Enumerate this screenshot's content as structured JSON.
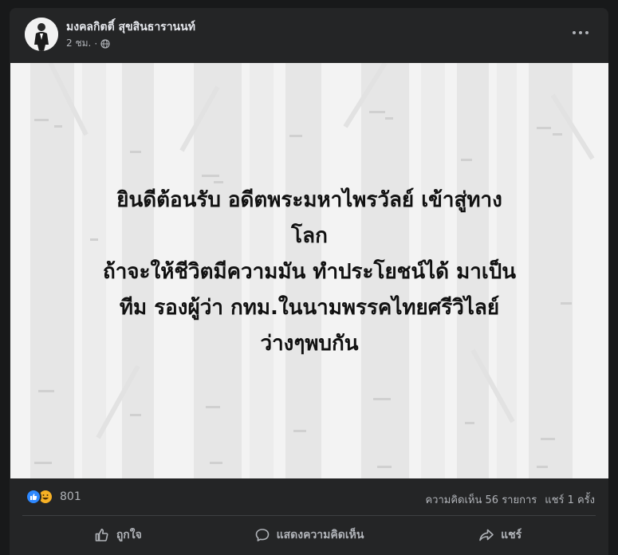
{
  "post": {
    "author": "มงคลกิตติ์ สุขสินธารานนท์",
    "time": "2 ชม.",
    "separator": "·",
    "privacy_icon": "globe-icon",
    "lines": [
      "ยินดีต้อนรับ อดีตพระมหาไพรวัลย์ เข้าสู่ทาง",
      "โลก",
      "ถ้าจะให้ชีวิตมีความมัน ทำประโยชน์ได้ มาเป็น",
      "ทีม รองผู้ว่า กทม.ในนามพรรคไทยศรีวิไลย์",
      "ว่างๆพบกัน"
    ]
  },
  "stats": {
    "reaction_count": "801",
    "comments": "ความคิดเห็น 56 รายการ",
    "shares": "แชร์ 1 ครั้ง"
  },
  "actions": {
    "like": "ถูกใจ",
    "comment": "แสดงความคิดเห็น",
    "share": "แชร์"
  },
  "colors": {
    "card_bg": "#242526",
    "page_bg": "#18191a",
    "text_primary": "#e4e6eb",
    "text_secondary": "#b0b3b8",
    "like_blue": "#2d88ff",
    "haha_yellow": "#f7b125"
  }
}
